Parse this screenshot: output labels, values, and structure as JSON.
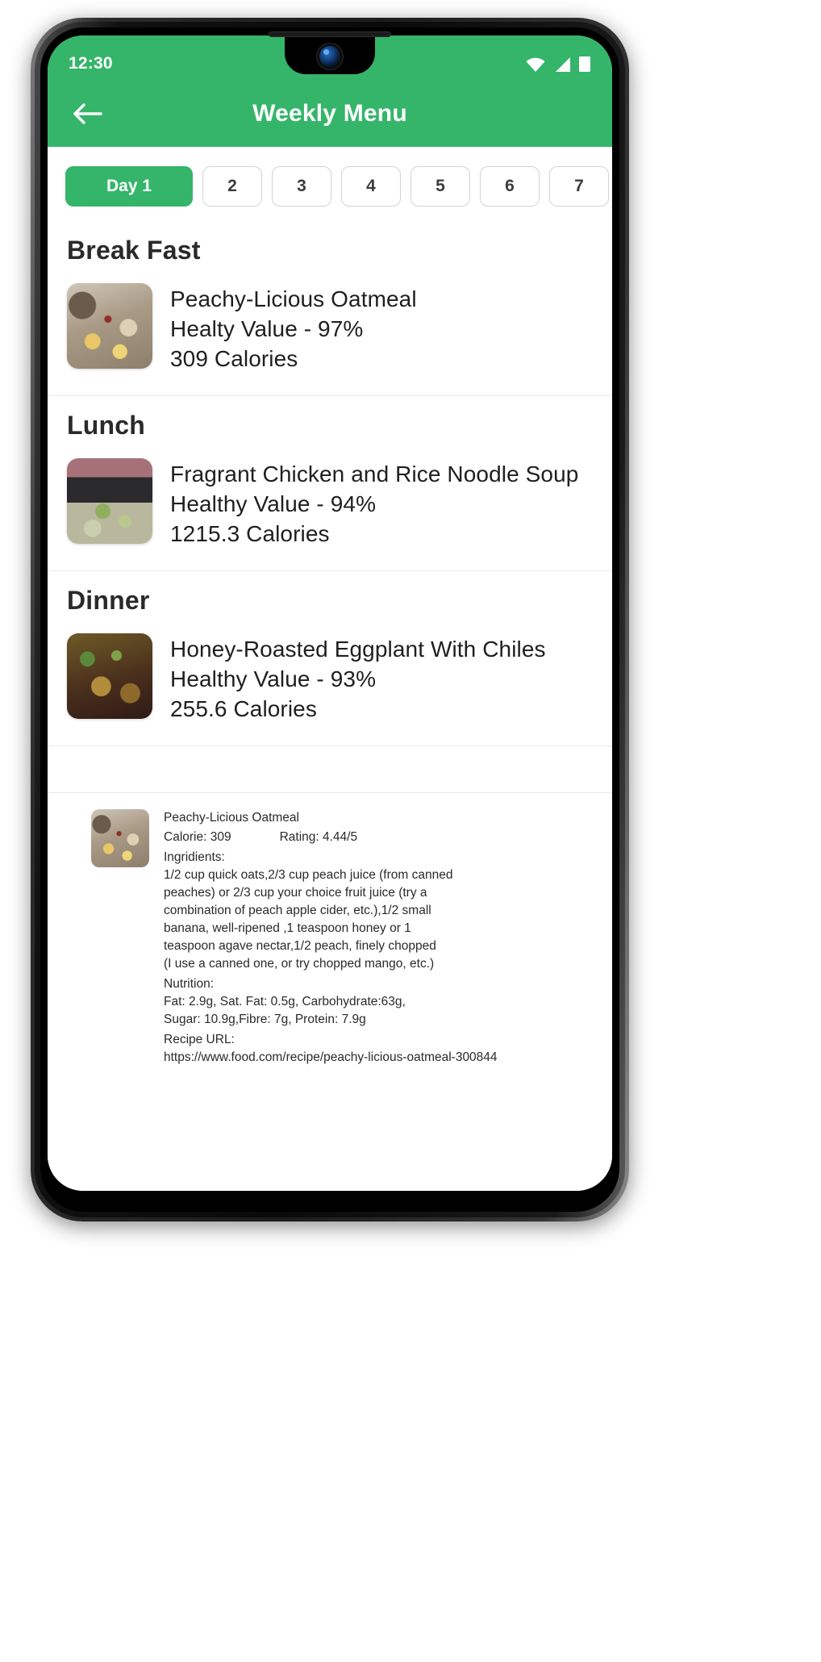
{
  "status_bar": {
    "time": "12:30",
    "icons": [
      "wifi-icon",
      "signal-icon",
      "battery-icon"
    ]
  },
  "app_bar": {
    "title": "Weekly Menu",
    "back_icon": "back-arrow-icon"
  },
  "theme": {
    "accent": "#35b56a",
    "accent_text": "#ffffff",
    "body_text": "#1f1f1f",
    "divider": "#e9e9e9"
  },
  "day_tabs": [
    {
      "label": "Day 1",
      "active": true
    },
    {
      "label": "2",
      "active": false
    },
    {
      "label": "3",
      "active": false
    },
    {
      "label": "4",
      "active": false
    },
    {
      "label": "5",
      "active": false
    },
    {
      "label": "6",
      "active": false
    },
    {
      "label": "7",
      "active": false
    }
  ],
  "sections": [
    {
      "heading": "Break Fast",
      "item": {
        "name": "Peachy-Licious Oatmeal",
        "health": "Healty Value - 97%",
        "calories": "309 Calories",
        "thumb": "oatmeal-photo"
      }
    },
    {
      "heading": "Lunch",
      "item": {
        "name": "Fragrant Chicken and Rice Noodle Soup",
        "health": "Healthy Value - 94%",
        "calories": "1215.3 Calories",
        "thumb": "soup-photo"
      }
    },
    {
      "heading": "Dinner",
      "item": {
        "name": "Honey-Roasted Eggplant With Chiles",
        "health": "Healthy Value - 93%",
        "calories": "255.6 Calories",
        "thumb": "eggplant-photo"
      }
    }
  ],
  "detail_card": {
    "thumb": "oatmeal-photo",
    "title": "Peachy-Licious Oatmeal",
    "calorie_label": "Calorie: 309",
    "rating_label": "Rating: 4.44/5",
    "ingredients_label": "Ingridients:",
    "ingredients_lines": [
      "1/2  cup    quick oats,2/3  cup    peach juice (from canned",
      "peaches) or 2/3  cup   your choice fruit juice (try a",
      "combination of peach apple cider, etc.),1/2  small",
      "banana, well-ripened ,1   teaspoon    honey or 1",
      "teaspoon    agave nectar,1/2     peach, finely chopped",
      "(I use a canned one, or try chopped mango, etc.)"
    ],
    "nutrition_label": "Nutrition:",
    "nutrition_lines": [
      "Fat: 2.9g, Sat. Fat: 0.5g, Carbohydrate:63g,",
      "Sugar: 10.9g,Fibre: 7g, Protein: 7.9g"
    ],
    "recipe_url_label": "Recipe URL:",
    "recipe_url": "https://www.food.com/recipe/peachy-licious-oatmeal-300844"
  }
}
